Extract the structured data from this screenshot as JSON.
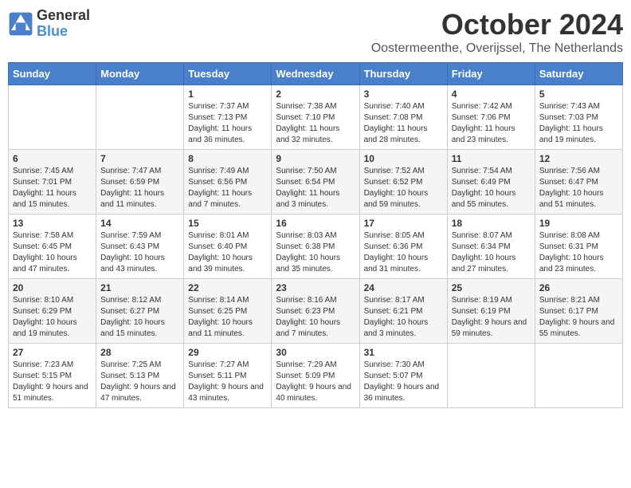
{
  "header": {
    "logo": {
      "line1": "General",
      "line2": "Blue"
    },
    "title": "October 2024",
    "location": "Oostermeenthe, Overijssel, The Netherlands"
  },
  "weekdays": [
    "Sunday",
    "Monday",
    "Tuesday",
    "Wednesday",
    "Thursday",
    "Friday",
    "Saturday"
  ],
  "weeks": [
    [
      {
        "day": "",
        "sunrise": "",
        "sunset": "",
        "daylight": ""
      },
      {
        "day": "",
        "sunrise": "",
        "sunset": "",
        "daylight": ""
      },
      {
        "day": "1",
        "sunrise": "Sunrise: 7:37 AM",
        "sunset": "Sunset: 7:13 PM",
        "daylight": "Daylight: 11 hours and 36 minutes."
      },
      {
        "day": "2",
        "sunrise": "Sunrise: 7:38 AM",
        "sunset": "Sunset: 7:10 PM",
        "daylight": "Daylight: 11 hours and 32 minutes."
      },
      {
        "day": "3",
        "sunrise": "Sunrise: 7:40 AM",
        "sunset": "Sunset: 7:08 PM",
        "daylight": "Daylight: 11 hours and 28 minutes."
      },
      {
        "day": "4",
        "sunrise": "Sunrise: 7:42 AM",
        "sunset": "Sunset: 7:06 PM",
        "daylight": "Daylight: 11 hours and 23 minutes."
      },
      {
        "day": "5",
        "sunrise": "Sunrise: 7:43 AM",
        "sunset": "Sunset: 7:03 PM",
        "daylight": "Daylight: 11 hours and 19 minutes."
      }
    ],
    [
      {
        "day": "6",
        "sunrise": "Sunrise: 7:45 AM",
        "sunset": "Sunset: 7:01 PM",
        "daylight": "Daylight: 11 hours and 15 minutes."
      },
      {
        "day": "7",
        "sunrise": "Sunrise: 7:47 AM",
        "sunset": "Sunset: 6:59 PM",
        "daylight": "Daylight: 11 hours and 11 minutes."
      },
      {
        "day": "8",
        "sunrise": "Sunrise: 7:49 AM",
        "sunset": "Sunset: 6:56 PM",
        "daylight": "Daylight: 11 hours and 7 minutes."
      },
      {
        "day": "9",
        "sunrise": "Sunrise: 7:50 AM",
        "sunset": "Sunset: 6:54 PM",
        "daylight": "Daylight: 11 hours and 3 minutes."
      },
      {
        "day": "10",
        "sunrise": "Sunrise: 7:52 AM",
        "sunset": "Sunset: 6:52 PM",
        "daylight": "Daylight: 10 hours and 59 minutes."
      },
      {
        "day": "11",
        "sunrise": "Sunrise: 7:54 AM",
        "sunset": "Sunset: 6:49 PM",
        "daylight": "Daylight: 10 hours and 55 minutes."
      },
      {
        "day": "12",
        "sunrise": "Sunrise: 7:56 AM",
        "sunset": "Sunset: 6:47 PM",
        "daylight": "Daylight: 10 hours and 51 minutes."
      }
    ],
    [
      {
        "day": "13",
        "sunrise": "Sunrise: 7:58 AM",
        "sunset": "Sunset: 6:45 PM",
        "daylight": "Daylight: 10 hours and 47 minutes."
      },
      {
        "day": "14",
        "sunrise": "Sunrise: 7:59 AM",
        "sunset": "Sunset: 6:43 PM",
        "daylight": "Daylight: 10 hours and 43 minutes."
      },
      {
        "day": "15",
        "sunrise": "Sunrise: 8:01 AM",
        "sunset": "Sunset: 6:40 PM",
        "daylight": "Daylight: 10 hours and 39 minutes."
      },
      {
        "day": "16",
        "sunrise": "Sunrise: 8:03 AM",
        "sunset": "Sunset: 6:38 PM",
        "daylight": "Daylight: 10 hours and 35 minutes."
      },
      {
        "day": "17",
        "sunrise": "Sunrise: 8:05 AM",
        "sunset": "Sunset: 6:36 PM",
        "daylight": "Daylight: 10 hours and 31 minutes."
      },
      {
        "day": "18",
        "sunrise": "Sunrise: 8:07 AM",
        "sunset": "Sunset: 6:34 PM",
        "daylight": "Daylight: 10 hours and 27 minutes."
      },
      {
        "day": "19",
        "sunrise": "Sunrise: 8:08 AM",
        "sunset": "Sunset: 6:31 PM",
        "daylight": "Daylight: 10 hours and 23 minutes."
      }
    ],
    [
      {
        "day": "20",
        "sunrise": "Sunrise: 8:10 AM",
        "sunset": "Sunset: 6:29 PM",
        "daylight": "Daylight: 10 hours and 19 minutes."
      },
      {
        "day": "21",
        "sunrise": "Sunrise: 8:12 AM",
        "sunset": "Sunset: 6:27 PM",
        "daylight": "Daylight: 10 hours and 15 minutes."
      },
      {
        "day": "22",
        "sunrise": "Sunrise: 8:14 AM",
        "sunset": "Sunset: 6:25 PM",
        "daylight": "Daylight: 10 hours and 11 minutes."
      },
      {
        "day": "23",
        "sunrise": "Sunrise: 8:16 AM",
        "sunset": "Sunset: 6:23 PM",
        "daylight": "Daylight: 10 hours and 7 minutes."
      },
      {
        "day": "24",
        "sunrise": "Sunrise: 8:17 AM",
        "sunset": "Sunset: 6:21 PM",
        "daylight": "Daylight: 10 hours and 3 minutes."
      },
      {
        "day": "25",
        "sunrise": "Sunrise: 8:19 AM",
        "sunset": "Sunset: 6:19 PM",
        "daylight": "Daylight: 9 hours and 59 minutes."
      },
      {
        "day": "26",
        "sunrise": "Sunrise: 8:21 AM",
        "sunset": "Sunset: 6:17 PM",
        "daylight": "Daylight: 9 hours and 55 minutes."
      }
    ],
    [
      {
        "day": "27",
        "sunrise": "Sunrise: 7:23 AM",
        "sunset": "Sunset: 5:15 PM",
        "daylight": "Daylight: 9 hours and 51 minutes."
      },
      {
        "day": "28",
        "sunrise": "Sunrise: 7:25 AM",
        "sunset": "Sunset: 5:13 PM",
        "daylight": "Daylight: 9 hours and 47 minutes."
      },
      {
        "day": "29",
        "sunrise": "Sunrise: 7:27 AM",
        "sunset": "Sunset: 5:11 PM",
        "daylight": "Daylight: 9 hours and 43 minutes."
      },
      {
        "day": "30",
        "sunrise": "Sunrise: 7:29 AM",
        "sunset": "Sunset: 5:09 PM",
        "daylight": "Daylight: 9 hours and 40 minutes."
      },
      {
        "day": "31",
        "sunrise": "Sunrise: 7:30 AM",
        "sunset": "Sunset: 5:07 PM",
        "daylight": "Daylight: 9 hours and 36 minutes."
      },
      {
        "day": "",
        "sunrise": "",
        "sunset": "",
        "daylight": ""
      },
      {
        "day": "",
        "sunrise": "",
        "sunset": "",
        "daylight": ""
      }
    ]
  ]
}
